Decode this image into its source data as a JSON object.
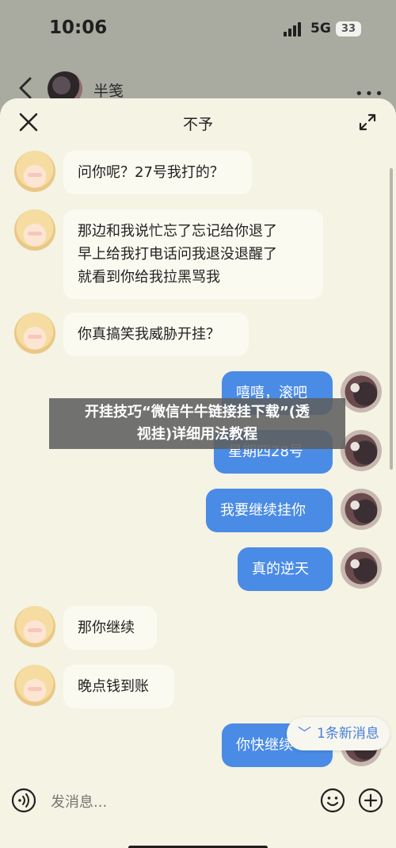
{
  "status": {
    "time": "10:06",
    "network": "5G",
    "battery": "33"
  },
  "background_chat": {
    "name": "半笺"
  },
  "sheet": {
    "title": "不予"
  },
  "messages": [
    {
      "side": "left",
      "text": "问你呢？27号我打的？"
    },
    {
      "side": "left",
      "lines": [
        "那边和我说忙忘了忘记给你退了",
        "早上给我打电话问我退没退醒了",
        "就看到你给我拉黑骂我"
      ]
    },
    {
      "side": "left",
      "text": "你真搞笑我威胁开挂？"
    },
    {
      "side": "right",
      "text": "嘻嘻，滚吧"
    },
    {
      "side": "right",
      "text": "星期四28号"
    },
    {
      "side": "right",
      "text": "我要继续挂你"
    },
    {
      "side": "right",
      "text": "真的逆天"
    },
    {
      "side": "left",
      "text": "那你继续"
    },
    {
      "side": "left",
      "text": "晚点钱到账"
    },
    {
      "side": "right",
      "text": "你快继续"
    }
  ],
  "new_message_pill": {
    "label": "1条新消息"
  },
  "input": {
    "placeholder": "发消息..."
  },
  "overlay_banner": {
    "line1": "开挂技巧“微信牛牛链接挂下载”(透",
    "line2": "视挂)详细用法教程"
  }
}
